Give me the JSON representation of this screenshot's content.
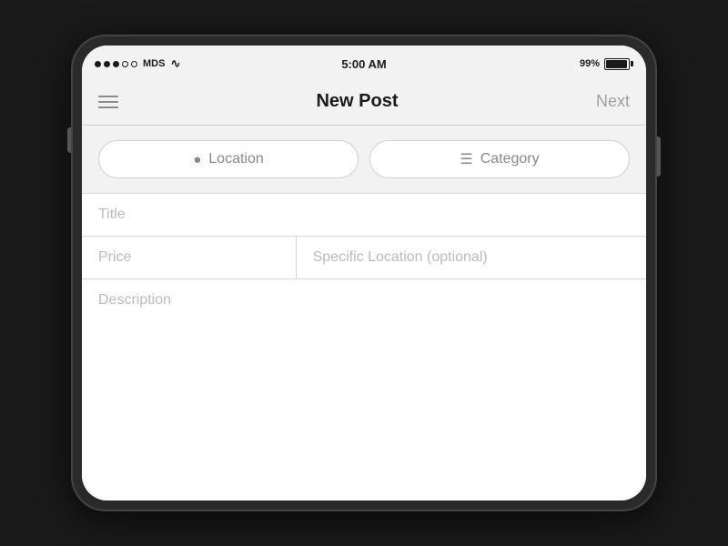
{
  "device": {
    "carrier": "MDS",
    "time": "5:00 AM",
    "battery_pct": "99%"
  },
  "nav": {
    "title": "New Post",
    "next_label": "Next",
    "menu_icon": "menu-icon"
  },
  "filters": {
    "location_label": "Location",
    "location_icon": "📍",
    "category_label": "Category",
    "category_icon": "≡"
  },
  "form": {
    "title_placeholder": "Title",
    "price_placeholder": "Price",
    "specific_location_placeholder": "Specific Location (optional)",
    "description_placeholder": "Description"
  }
}
